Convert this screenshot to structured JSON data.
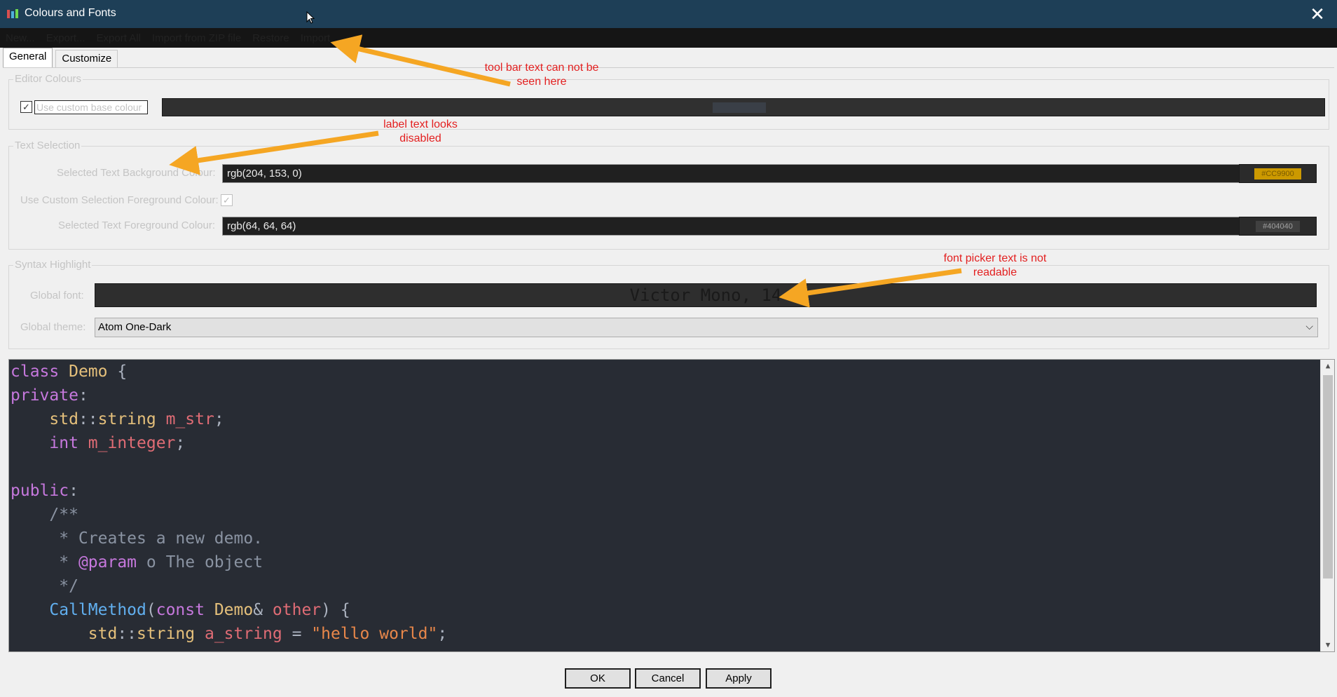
{
  "window": {
    "title": "Colours and Fonts",
    "close_glyph": "✕"
  },
  "toolbar": {
    "items": [
      "New...",
      "Export...",
      "Export All",
      "Import from ZIP file",
      "Restore",
      "Import"
    ]
  },
  "tabs": [
    "General",
    "Customize"
  ],
  "editor_colours": {
    "legend": "Editor Colours",
    "checkbox_label": "Use custom base colour",
    "checked": true
  },
  "text_selection": {
    "legend": "Text Selection",
    "bg_label": "Selected Text Background Colour:",
    "bg_value": "rgb(204, 153, 0)",
    "bg_hex": "#CC9900",
    "fg_use_label": "Use Custom Selection Foreground Colour:",
    "fg_use_checked": true,
    "fg_label": "Selected Text Foreground Colour:",
    "fg_value": "rgb(64, 64, 64)",
    "fg_hex": "#404040"
  },
  "syntax": {
    "legend": "Syntax Highlight",
    "font_label": "Global font:",
    "font_value": "Victor Mono, 14",
    "theme_label": "Global theme:",
    "theme_value": "Atom One-Dark"
  },
  "code_lines": [
    [
      [
        "class ",
        "kw"
      ],
      [
        "Demo",
        "cls"
      ],
      [
        " {",
        "pun"
      ]
    ],
    [
      [
        "private",
        "kw"
      ],
      [
        ":",
        "pun"
      ]
    ],
    [
      [
        "    std",
        "cls"
      ],
      [
        "::",
        "pun"
      ],
      [
        "string ",
        "cls"
      ],
      [
        "m_str",
        "fld"
      ],
      [
        ";",
        "pun"
      ]
    ],
    [
      [
        "    int ",
        "kw"
      ],
      [
        "m_integer",
        "fld"
      ],
      [
        ";",
        "pun"
      ]
    ],
    [
      [
        "",
        "pun"
      ]
    ],
    [
      [
        "public",
        "kw"
      ],
      [
        ":",
        "pun"
      ]
    ],
    [
      [
        "    /**",
        "cmt"
      ]
    ],
    [
      [
        "     * Creates a new demo.",
        "cmt"
      ]
    ],
    [
      [
        "     * ",
        "cmt"
      ],
      [
        "@param",
        "tag"
      ],
      [
        " o The object",
        "cmt"
      ]
    ],
    [
      [
        "     */",
        "cmt"
      ]
    ],
    [
      [
        "    CallMethod",
        "fn"
      ],
      [
        "(",
        "pun"
      ],
      [
        "const ",
        "kw"
      ],
      [
        "Demo",
        "cls"
      ],
      [
        "& ",
        "pun"
      ],
      [
        "other",
        "fld"
      ],
      [
        ") {",
        "pun"
      ]
    ],
    [
      [
        "        std",
        "cls"
      ],
      [
        "::",
        "pun"
      ],
      [
        "string ",
        "cls"
      ],
      [
        "a_string",
        "fld"
      ],
      [
        " = ",
        "pun"
      ],
      [
        "\"hello world\"",
        "str"
      ],
      [
        ";",
        "pun"
      ]
    ]
  ],
  "buttons": {
    "ok": "OK",
    "cancel": "Cancel",
    "apply": "Apply"
  },
  "annotations": {
    "toolbar_note": "tool bar text can not be seen here",
    "label_note": "label text looks disabled",
    "font_note": "font picker text is not readable"
  },
  "colors": {
    "titlebar": "#1e3f57",
    "toolbar": "#151515",
    "annotation": "#e32020",
    "arrow": "#f5a623",
    "editor_bg": "#282c34"
  }
}
